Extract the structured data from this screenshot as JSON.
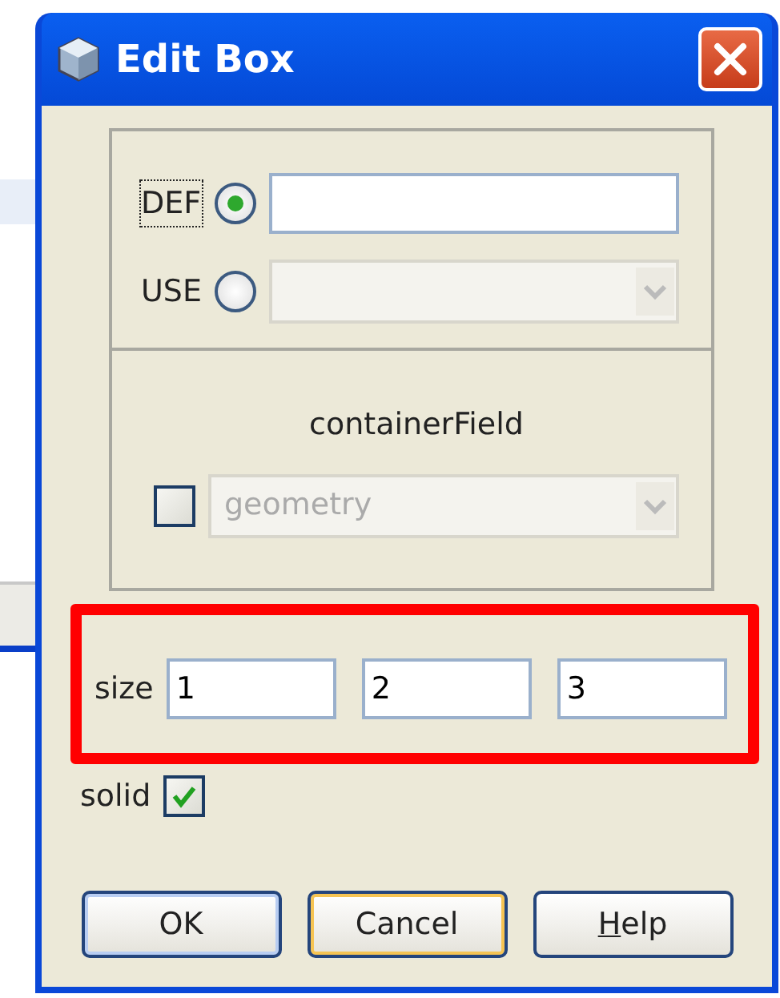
{
  "window": {
    "title": "Edit Box"
  },
  "def": {
    "label": "DEF",
    "selected": true
  },
  "use": {
    "label": "USE",
    "selected": false,
    "disabled": true
  },
  "container_field": {
    "label": "containerField",
    "checked": false,
    "value": "geometry",
    "disabled": true
  },
  "size": {
    "label": "size",
    "values": [
      "1",
      "2",
      "3"
    ],
    "highlighted": true
  },
  "solid": {
    "label": "solid",
    "checked": true
  },
  "buttons": [
    {
      "label": "OK",
      "kind": "default",
      "underline_first": false
    },
    {
      "label": "Cancel",
      "kind": "focused",
      "underline_first": false
    },
    {
      "label": "Help",
      "kind": "plain",
      "underline_first": true
    }
  ]
}
